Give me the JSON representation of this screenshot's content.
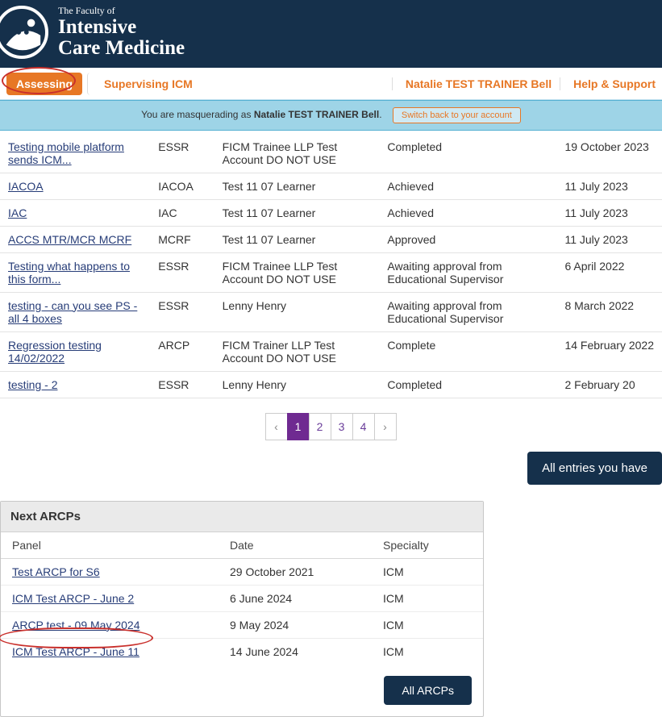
{
  "header": {
    "faculty_prefix": "The Faculty of",
    "line1": "Intensive",
    "line2": "Care Medicine"
  },
  "nav": {
    "assessing": "Assessing",
    "supervising": "Supervising ICM",
    "user": "Natalie TEST TRAINER Bell",
    "help": "Help & Support"
  },
  "masq": {
    "prefix": "You are masquerading as ",
    "who": "Natalie TEST TRAINER Bell",
    "suffix": ".",
    "switch": "Switch back to your account"
  },
  "entries": [
    {
      "title": "Testing mobile platform sends ICM...",
      "type": "ESSR",
      "learner": "FICM Trainee LLP Test Account DO NOT USE",
      "status": "Completed",
      "date": "19 October 2023"
    },
    {
      "title": "IACOA",
      "type": "IACOA",
      "learner": "Test 11 07 Learner",
      "status": "Achieved",
      "date": "11 July 2023"
    },
    {
      "title": "IAC",
      "type": "IAC",
      "learner": "Test 11 07 Learner",
      "status": "Achieved",
      "date": "11 July 2023"
    },
    {
      "title": "ACCS MTR/MCR MCRF",
      "type": "MCRF",
      "learner": "Test 11 07 Learner",
      "status": "Approved",
      "date": "11 July 2023"
    },
    {
      "title": "Testing what happens to this form...",
      "type": "ESSR",
      "learner": "FICM Trainee LLP Test Account DO NOT USE",
      "status": "Awaiting approval from Educational Supervisor",
      "date": "6 April 2022"
    },
    {
      "title": "testing - can you see PS - all 4 boxes",
      "type": "ESSR",
      "learner": "Lenny Henry",
      "status": "Awaiting approval from Educational Supervisor",
      "date": "8 March 2022"
    },
    {
      "title": "Regression testing 14/02/2022",
      "type": "ARCP",
      "learner": "FICM Trainer LLP Test Account DO NOT USE",
      "status": "Complete",
      "date": "14 February 2022"
    },
    {
      "title": "testing - 2",
      "type": "ESSR",
      "learner": "Lenny Henry",
      "status": "Completed",
      "date": "2 February 20"
    }
  ],
  "pager": {
    "prev": "‹",
    "pages": [
      "1",
      "2",
      "3",
      "4"
    ],
    "current": "1",
    "next": "›"
  },
  "all_entries_btn": "All entries you have",
  "arcp": {
    "title": "Next ARCPs",
    "headers": {
      "panel": "Panel",
      "date": "Date",
      "spec": "Specialty"
    },
    "rows": [
      {
        "panel": "Test ARCP for S6",
        "date": "29 October 2021",
        "spec": "ICM"
      },
      {
        "panel": "ICM Test ARCP - June 2",
        "date": "6 June 2024",
        "spec": "ICM"
      },
      {
        "panel": "ARCP test - 09 May 2024",
        "date": "9 May 2024",
        "spec": "ICM"
      },
      {
        "panel": "ICM Test ARCP - June 11",
        "date": "14 June 2024",
        "spec": "ICM"
      }
    ],
    "all_btn": "All ARCPs"
  }
}
